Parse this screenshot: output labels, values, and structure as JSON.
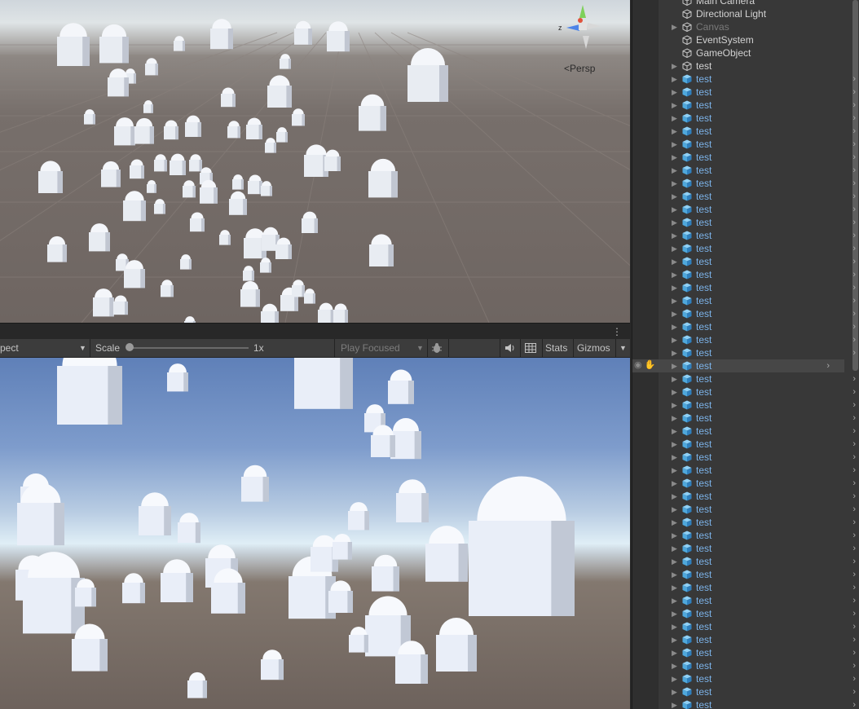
{
  "scene": {
    "view_mode_label": "Persp",
    "axis_z_label": "z"
  },
  "toolbar": {
    "display_label": "pect",
    "scale_label": "Scale",
    "scale_value": "1x",
    "scale_fraction": 0.0,
    "play_mode_label": "Play Focused",
    "stats_label": "Stats",
    "gizmos_label": "Gizmos",
    "menu_icon": "kebab-menu-icon"
  },
  "hierarchy": {
    "items": [
      {
        "label": "Main Camera",
        "icon": "gameobject-icon",
        "style": "white",
        "foldout": false,
        "chevron": false
      },
      {
        "label": "Directional Light",
        "icon": "gameobject-icon",
        "style": "white",
        "foldout": false,
        "chevron": false
      },
      {
        "label": "Canvas",
        "icon": "gameobject-icon",
        "style": "gray",
        "foldout": true,
        "chevron": false
      },
      {
        "label": "EventSystem",
        "icon": "gameobject-icon",
        "style": "white",
        "foldout": false,
        "chevron": false
      },
      {
        "label": "GameObject",
        "icon": "gameobject-icon",
        "style": "white",
        "foldout": false,
        "chevron": false
      },
      {
        "label": "test",
        "icon": "gameobject-icon",
        "style": "white",
        "foldout": true,
        "chevron": false
      }
    ],
    "prefab_label": "test",
    "prefab_icon": "prefab-cube-icon",
    "prefab_count": 49,
    "selected_index": 22
  },
  "colors": {
    "prefab_blue": "#7cb3e9",
    "panel_bg": "#383838",
    "toolbar_bg": "#3c3c3c"
  }
}
